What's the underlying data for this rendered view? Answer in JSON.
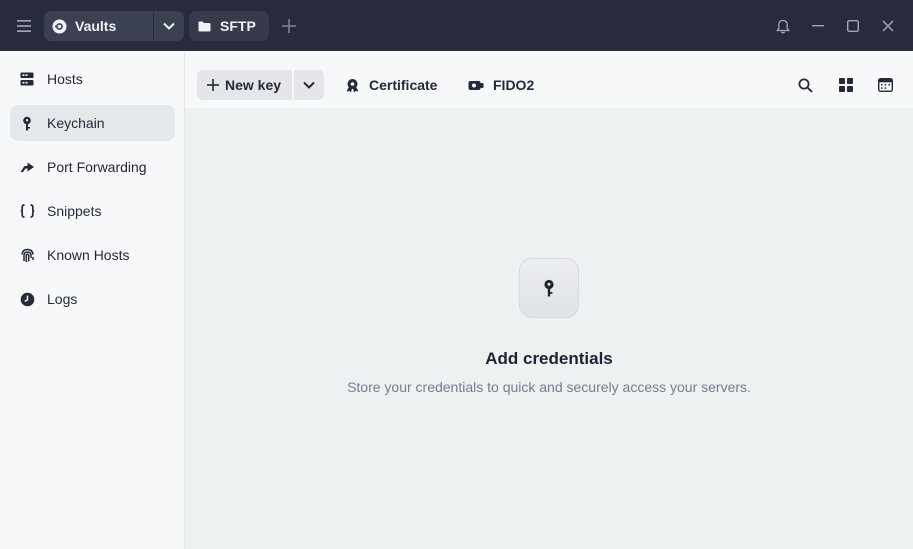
{
  "titlebar": {
    "vault_label": "Vaults",
    "tab_label": "SFTP"
  },
  "sidebar": {
    "items": [
      {
        "label": "Hosts",
        "icon": "hosts-icon"
      },
      {
        "label": "Keychain",
        "icon": "key-icon",
        "active": true
      },
      {
        "label": "Port Forwarding",
        "icon": "port-forwarding-icon"
      },
      {
        "label": "Snippets",
        "icon": "braces-icon"
      },
      {
        "label": "Known Hosts",
        "icon": "fingerprint-icon"
      },
      {
        "label": "Logs",
        "icon": "clock-icon"
      }
    ]
  },
  "toolbar": {
    "new_key_label": "New key",
    "certificate_label": "Certificate",
    "fido2_label": "FIDO2"
  },
  "empty_state": {
    "title": "Add credentials",
    "subtitle": "Store your credentials to quick and securely access your servers."
  },
  "colors": {
    "titlebar_bg": "#272b3c",
    "sidebar_bg": "#f7f8fa",
    "content_bg": "#eef1f2",
    "active_item_bg": "#e5e8eb"
  }
}
